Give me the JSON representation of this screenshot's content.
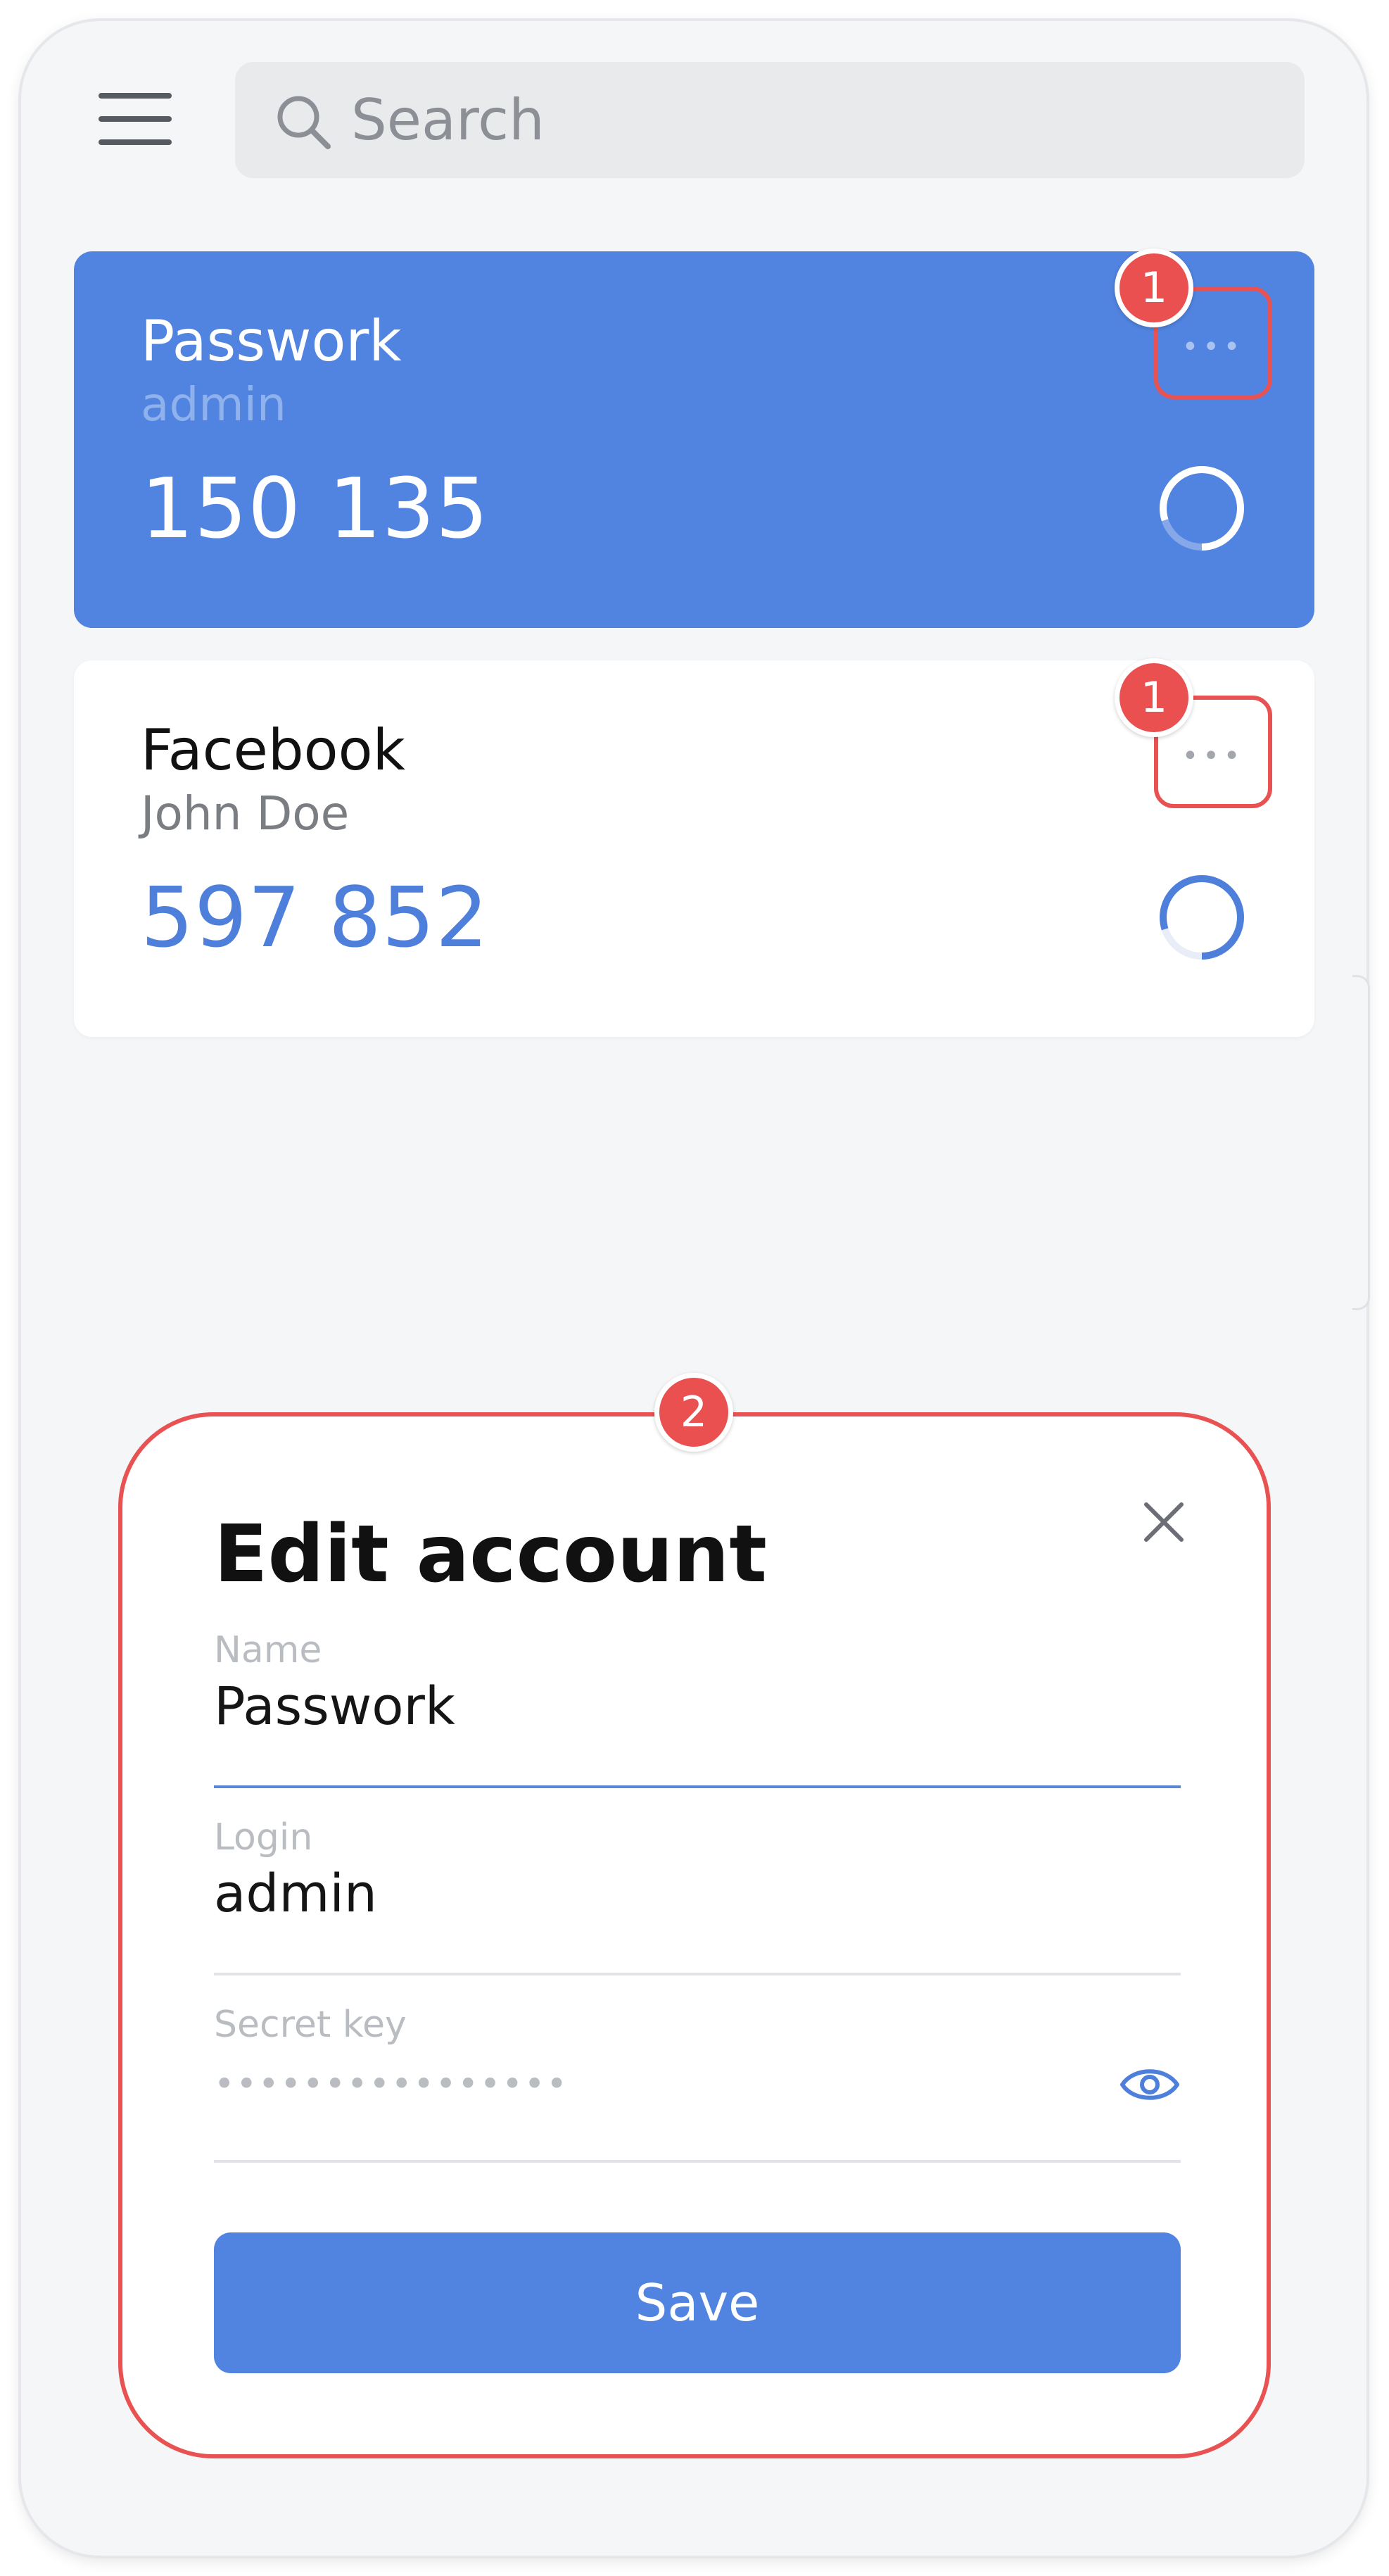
{
  "search": {
    "placeholder": "Search"
  },
  "accounts": [
    {
      "name": "Passwork",
      "login": "admin",
      "code": "150 135",
      "badge": "1",
      "more_label": "•••",
      "timer_remaining": 0.8
    },
    {
      "name": "Facebook",
      "login": "John Doe",
      "code": "597 852",
      "badge": "1",
      "more_label": "•••",
      "timer_remaining": 0.8
    }
  ],
  "edit_modal": {
    "badge": "2",
    "title": "Edit account",
    "fields": {
      "name": {
        "label": "Name",
        "value": "Passwork"
      },
      "login": {
        "label": "Login",
        "value": "admin"
      },
      "secret": {
        "label": "Secret key",
        "value": "••••••••••••••••"
      }
    },
    "save_label": "Save"
  },
  "colors": {
    "accent": "#5184e0",
    "annotation": "#e85252",
    "background": "#f5f6f8"
  },
  "icons": {
    "menu": "hamburger-icon",
    "search": "search-icon",
    "close": "close-icon",
    "reveal": "eye-icon",
    "timer": "countdown-ring-icon"
  }
}
